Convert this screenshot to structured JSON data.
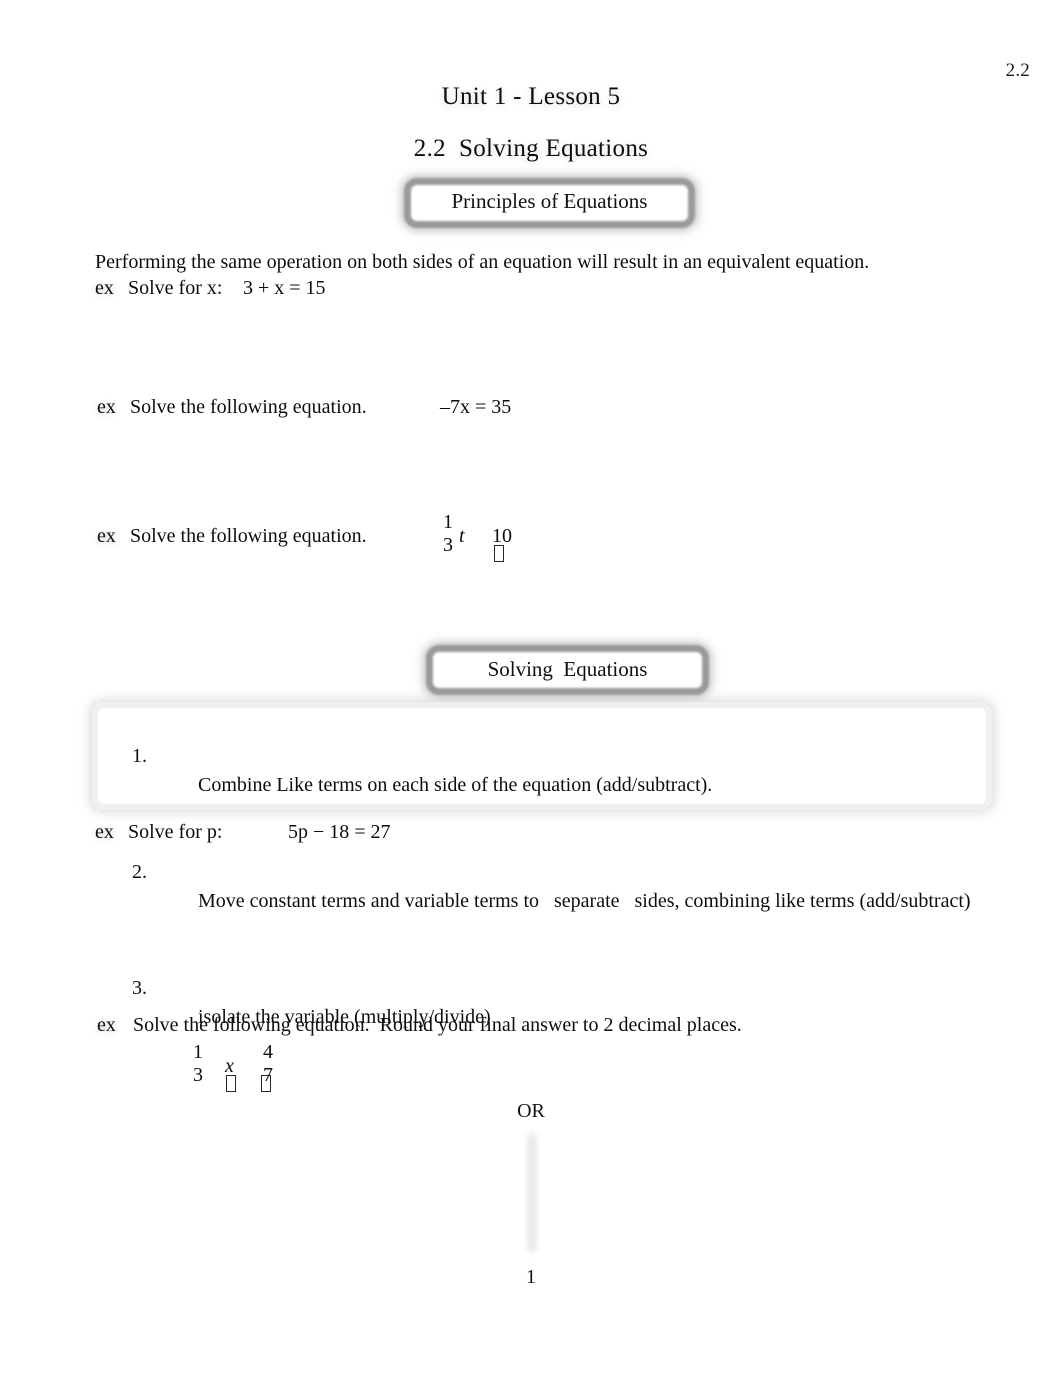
{
  "header": {
    "corner_label": "2.2",
    "title": "Unit 1 - Lesson 5",
    "subtitle": "2.2  Solving Equations"
  },
  "sections": {
    "principles": {
      "callout_label": "Principles of Equations",
      "intro_sentence": "Performing the same operation on both sides of an equation will result in an equivalent equation.",
      "examples": [
        {
          "label": "ex",
          "text": "Solve for x:",
          "equation": "3 + x = 15"
        },
        {
          "label": "ex",
          "text": "Solve the following equation.",
          "equation": "–7x = 35"
        },
        {
          "label": "ex",
          "text": "Solve the following equation.",
          "fraction": {
            "numerator": "1",
            "denominator": "3"
          },
          "variable": "t",
          "operator_glyph": "missing-glyph",
          "right_side": "10"
        }
      ]
    },
    "solving": {
      "callout_label": "Solving  Equations",
      "steps": [
        {
          "marker": "1.",
          "text": "Combine Like terms on each side of the equation (add/subtract)."
        },
        {
          "marker": "2.",
          "text": "Move constant terms and variable terms to   separate   sides, combining like terms (add/subtract)"
        },
        {
          "marker": "3.",
          "text": "isolate the variable (multiply/divide)"
        }
      ],
      "examples": [
        {
          "label": "ex",
          "text": "Solve for p:",
          "equation": "5p − 18 = 27"
        },
        {
          "label": "ex",
          "text": "Solve the following equation.  Round your final answer to 2 decimal places.",
          "fraction_left": {
            "numerator": "1",
            "denominator": "3"
          },
          "operator_glyph_1": "missing-glyph",
          "variable": "x",
          "operator_glyph_2": "missing-glyph",
          "fraction_right": {
            "numerator": "4",
            "denominator": "7"
          }
        }
      ],
      "or_label": "OR"
    }
  },
  "footer": {
    "page_number": "1"
  }
}
